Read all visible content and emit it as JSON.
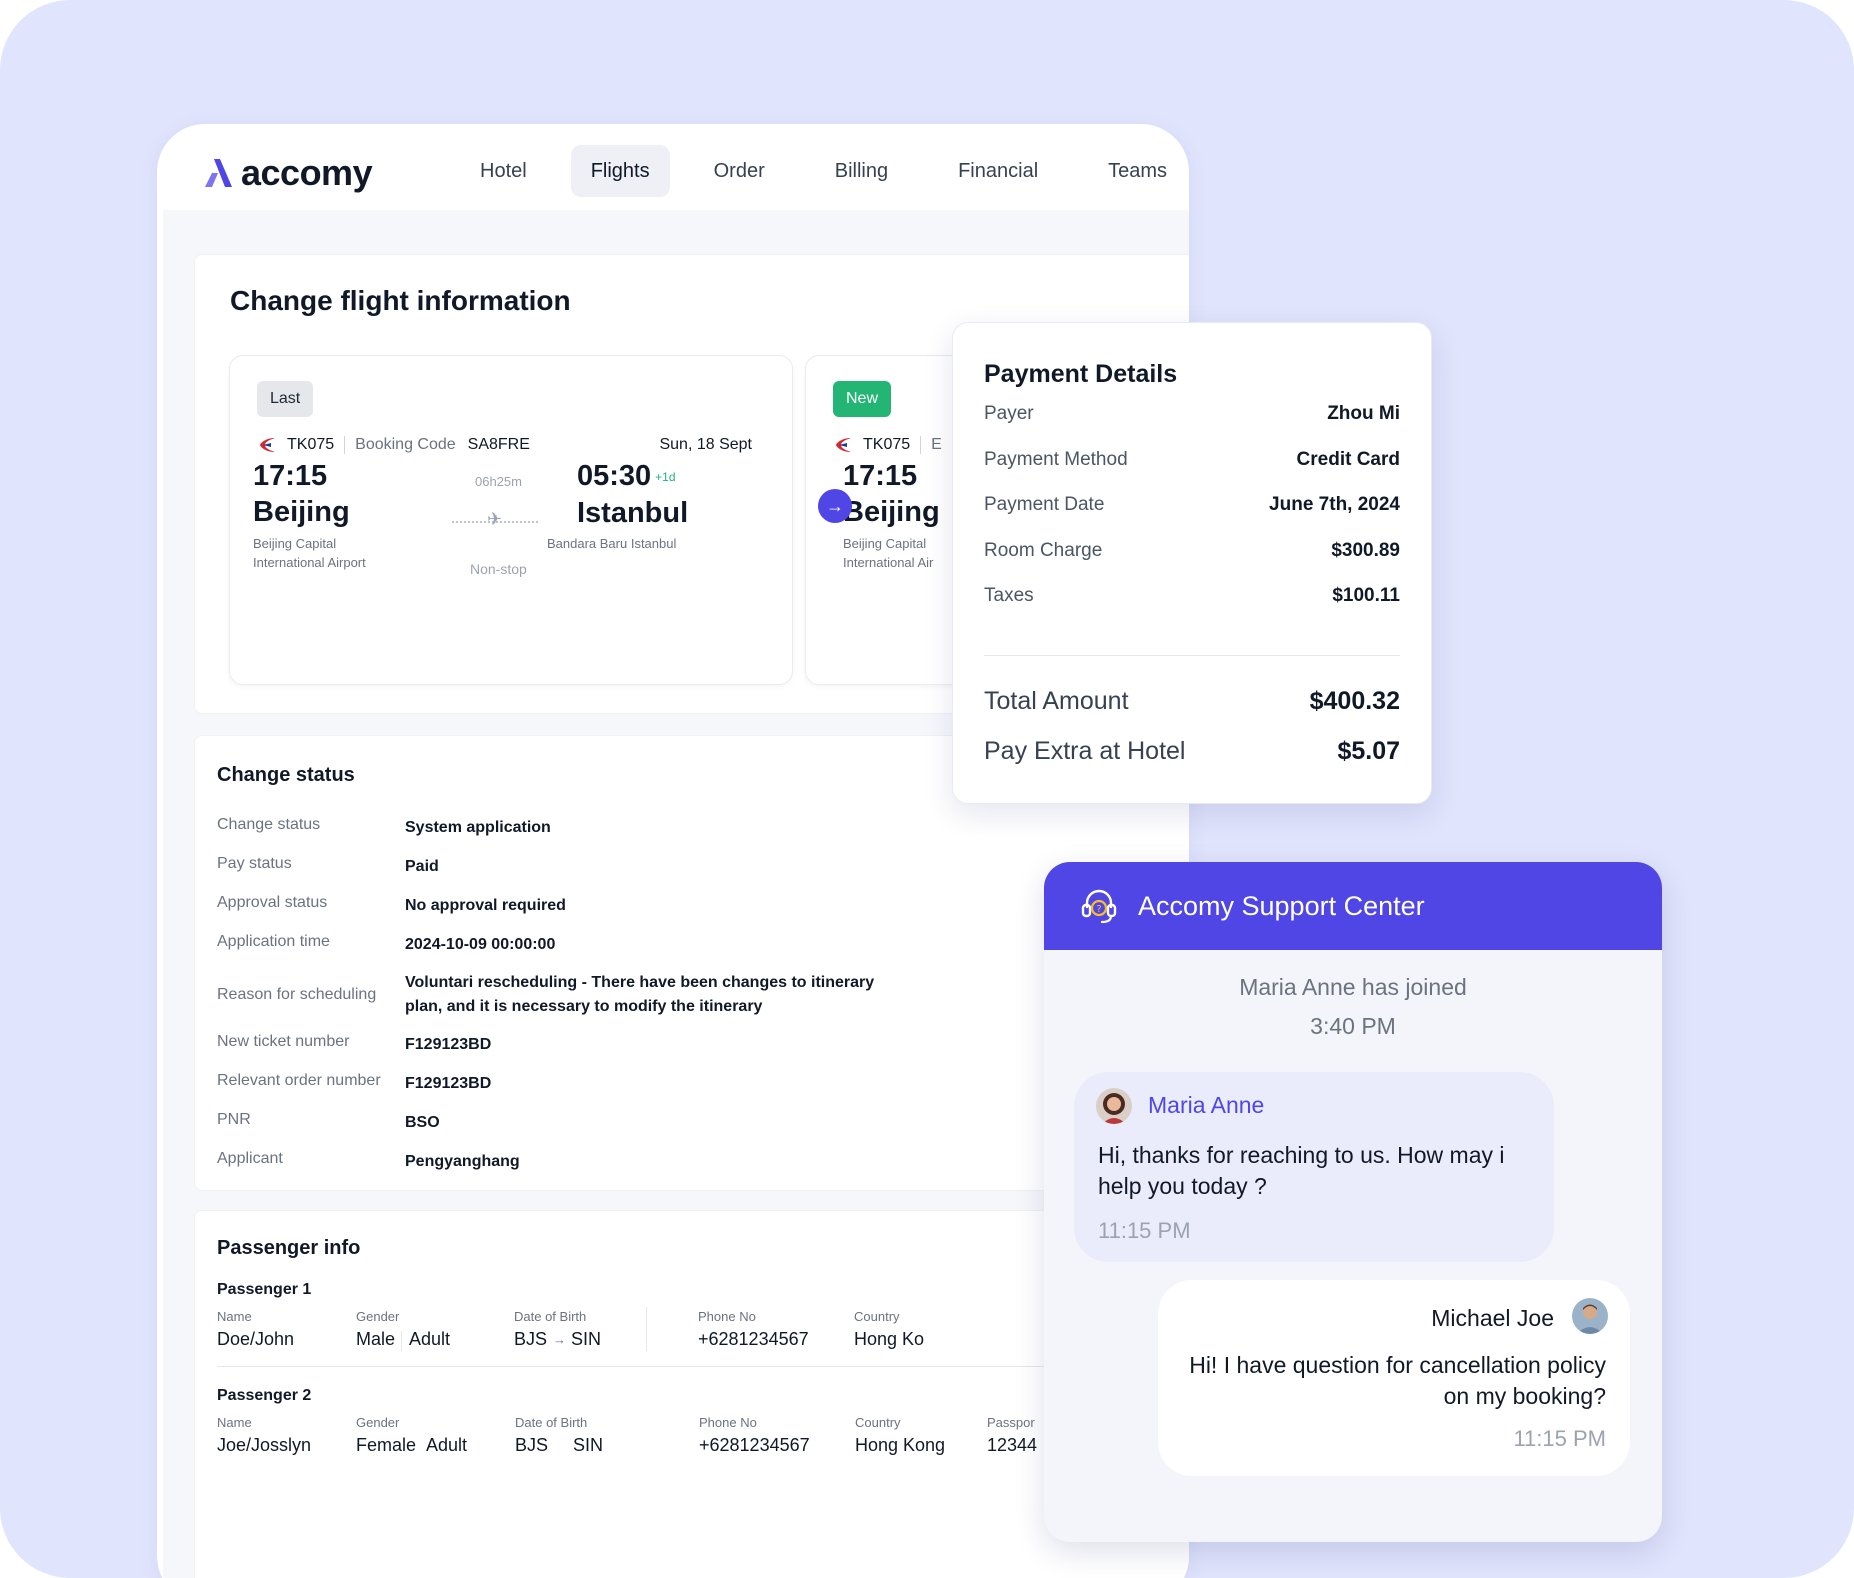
{
  "app": {
    "logo_text": "accomy"
  },
  "nav": [
    {
      "label": "Hotel"
    },
    {
      "label": "Flights",
      "active": true
    },
    {
      "label": "Order"
    },
    {
      "label": "Billing"
    },
    {
      "label": "Financial"
    },
    {
      "label": "Teams"
    }
  ],
  "change_flight": {
    "title": "Change flight information",
    "last": {
      "tag": "Last",
      "flight_code": "TK075",
      "booking_code_label": "Booking Code",
      "booking_code": "SA8FRE",
      "date": "Sun, 18 Sept",
      "depart_time": "17:15",
      "depart_city": "Beijing",
      "depart_airport_line1": "Beijing Capital",
      "depart_airport_line2": "International Airport",
      "duration": "06h25m",
      "stops": "Non-stop",
      "arrive_time": "05:30",
      "arrive_offset": "+1d",
      "arrive_city": "Istanbul",
      "arrive_airport": "Bandara Baru Istanbul"
    },
    "new": {
      "tag": "New",
      "flight_code": "TK075",
      "booking_code_partial": "E",
      "depart_time": "17:15",
      "depart_city": "Beijing",
      "depart_airport_line1": "Beijing Capital",
      "depart_airport_line2": "International Air"
    }
  },
  "change_status": {
    "title": "Change status",
    "rows": [
      {
        "label": "Change status",
        "value": "System application"
      },
      {
        "label": "Pay status",
        "value": "Paid"
      },
      {
        "label": "Approval status",
        "value": "No approval required"
      },
      {
        "label": "Application time",
        "value": "2024-10-09 00:00:00"
      },
      {
        "label": "Reason for scheduling",
        "value": "Voluntari rescheduling - There have been changes to itinerary plan, and it is necessary to modify the itinerary"
      },
      {
        "label": "New ticket number",
        "value": "F129123BD"
      },
      {
        "label": "Relevant order number",
        "value": "F129123BD"
      },
      {
        "label": "PNR",
        "value": "BSO"
      },
      {
        "label": "Applicant",
        "value": "Pengyanghang"
      }
    ]
  },
  "passenger_info": {
    "title": "Passenger info",
    "columns": {
      "name": "Name",
      "gender": "Gender",
      "dob": "Date of Birth",
      "phone": "Phone No",
      "country": "Country",
      "passport": "Passpor"
    },
    "passengers": [
      {
        "label": "Passenger 1",
        "name": "Doe/John",
        "gender": "Male",
        "type": "Adult",
        "from": "BJS",
        "to": "SIN",
        "phone": "+6281234567",
        "country": "Hong Ko"
      },
      {
        "label": "Passenger 2",
        "name": "Joe/Josslyn",
        "gender": "Female",
        "type": "Adult",
        "from": "BJS",
        "to": "SIN",
        "phone": "+6281234567",
        "country": "Hong Kong",
        "passport": "12344"
      }
    ]
  },
  "payment": {
    "title": "Payment Details",
    "rows": [
      {
        "label": "Payer",
        "value": "Zhou Mi"
      },
      {
        "label": "Payment Method",
        "value": "Credit Card"
      },
      {
        "label": "Payment Date",
        "value": "June 7th, 2024"
      },
      {
        "label": "Room Charge",
        "value": "$300.89"
      },
      {
        "label": "Taxes",
        "value": "$100.11"
      }
    ],
    "total_label": "Total Amount",
    "total_value": "$400.32",
    "extra_label": "Pay Extra at Hotel",
    "extra_value": "$5.07"
  },
  "support": {
    "title": "Accomy Support Center",
    "system_message": "Maria Anne has joined",
    "system_time": "3:40 PM",
    "incoming": {
      "name": "Maria Anne",
      "text": "Hi, thanks for reaching to us. How may i help you today ?",
      "time": "11:15 PM"
    },
    "outgoing": {
      "name": "Michael Joe",
      "text": "Hi! I have question for cancellation policy on my booking?",
      "time": "11:15 PM"
    }
  },
  "colors": {
    "accent": "#4f46e5",
    "success": "#22b573",
    "background": "#e0e4fc"
  }
}
